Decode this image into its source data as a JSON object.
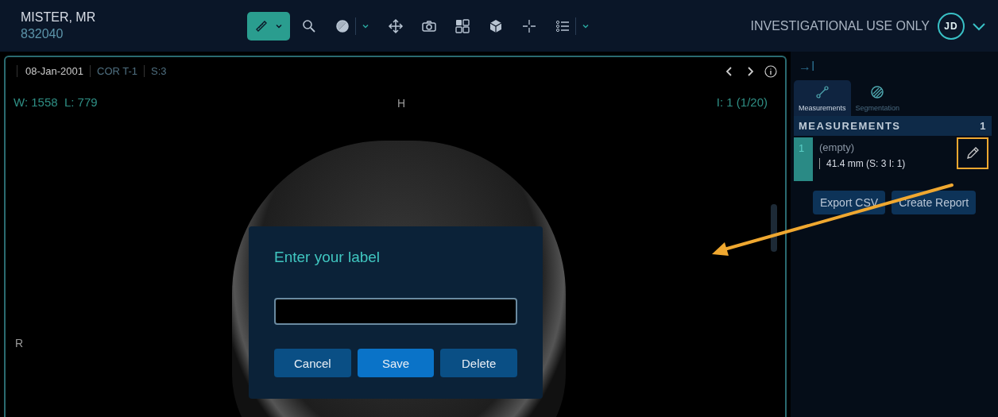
{
  "patient": {
    "name": "MISTER, MR",
    "id": "832040"
  },
  "toolbar": [
    {
      "kind": "ruler",
      "selected": true,
      "dropdown": true
    },
    {
      "kind": "search",
      "selected": false,
      "dropdown": false
    },
    {
      "kind": "contrast",
      "selected": false,
      "dropdown": true
    },
    {
      "kind": "move",
      "selected": false,
      "dropdown": false
    },
    {
      "kind": "camera",
      "selected": false,
      "dropdown": false
    },
    {
      "kind": "layout",
      "selected": false,
      "dropdown": false
    },
    {
      "kind": "cube",
      "selected": false,
      "dropdown": false
    },
    {
      "kind": "crosshair",
      "selected": false,
      "dropdown": false
    },
    {
      "kind": "list",
      "selected": false,
      "dropdown": true
    }
  ],
  "notice": "INVESTIGATIONAL USE ONLY",
  "user_initials": "JD",
  "viewport": {
    "date": "08-Jan-2001",
    "series": "COR T-1",
    "slice": "S:3",
    "window_level": "W: 1558  L: 779",
    "orientation_top": "H",
    "orientation_left": "R",
    "image_index": "I: 1 (1/20)"
  },
  "dialog": {
    "title": "Enter your label",
    "buttons": [
      {
        "label": "Cancel",
        "primary": false
      },
      {
        "label": "Save",
        "primary": true
      },
      {
        "label": "Delete",
        "primary": false
      }
    ]
  },
  "panel": {
    "collapse_glyph": "→I",
    "tabs": [
      {
        "kind": "measure",
        "label": "Measurements",
        "selected": true
      },
      {
        "kind": "segment",
        "label": "Segmentation",
        "selected": false
      }
    ],
    "section_title": "MEASUREMENTS",
    "count": "1",
    "measurements": [
      {
        "index": "1",
        "label": "(empty)",
        "value": "41.4 mm (S: 3 I: 1)"
      }
    ],
    "buttons": [
      "Export CSV",
      "Create Report"
    ]
  }
}
